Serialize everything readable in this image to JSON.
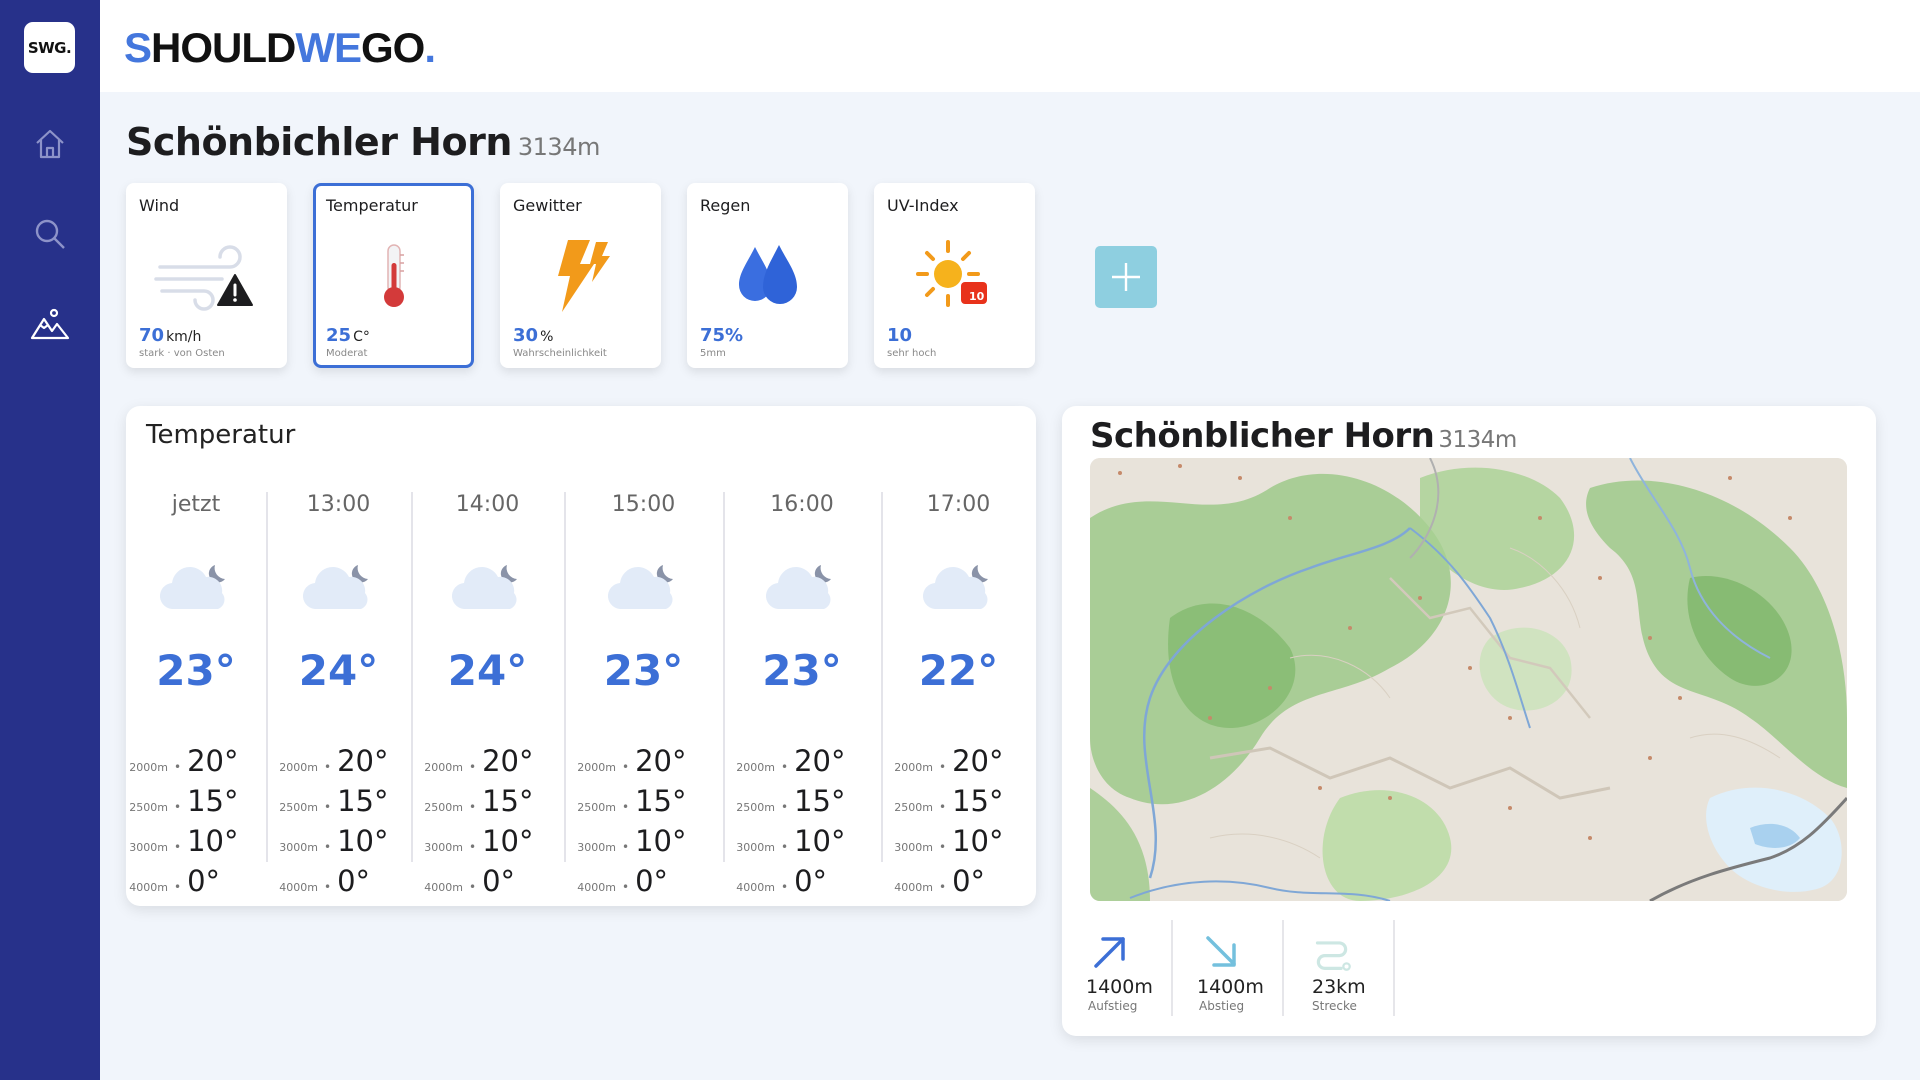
{
  "app": {
    "logo_text": "SWG.",
    "brand_part1": "S",
    "brand_part2": "HOULD",
    "brand_part3": "WE",
    "brand_part4": "GO",
    "brand_part5": ".",
    "accent_color": "#3c6fd6",
    "sidebar_color": "#27318a"
  },
  "sidebar": {
    "items": [
      {
        "name": "home",
        "icon": "home-icon"
      },
      {
        "name": "search",
        "icon": "search-icon"
      },
      {
        "name": "mountains",
        "icon": "mountain-icon"
      }
    ]
  },
  "page": {
    "title": "Schönbichler Horn",
    "altitude": "3134m"
  },
  "metrics": [
    {
      "label": "Wind",
      "value": "70",
      "unit": "km/h",
      "sub": "stark · von Osten",
      "icon": "wind-warning-icon"
    },
    {
      "label": "Temperatur",
      "value": "25",
      "unit": "C°",
      "sub": "Moderat",
      "icon": "thermometer-icon",
      "selected": true
    },
    {
      "label": "Gewitter",
      "value": "30",
      "unit": "%",
      "sub": "Wahrscheinlichkeit",
      "icon": "lightning-icon"
    },
    {
      "label": "Regen",
      "value": "75%",
      "unit": "",
      "sub": "5mm",
      "icon": "raindrops-icon"
    },
    {
      "label": "UV-Index",
      "value": "10",
      "unit": "",
      "sub": "sehr hoch",
      "icon": "sun-uv-icon",
      "badge": "10"
    }
  ],
  "temperature": {
    "title": "Temperatur",
    "hours": [
      {
        "time": "jetzt",
        "temp": "23°",
        "alts": [
          {
            "alt": "2000m",
            "val": "20°"
          },
          {
            "alt": "2500m",
            "val": "15°"
          },
          {
            "alt": "3000m",
            "val": "10°"
          },
          {
            "alt": "4000m",
            "val": "0°"
          }
        ]
      },
      {
        "time": "13:00",
        "temp": "24°",
        "alts": [
          {
            "alt": "2000m",
            "val": "20°"
          },
          {
            "alt": "2500m",
            "val": "15°"
          },
          {
            "alt": "3000m",
            "val": "10°"
          },
          {
            "alt": "4000m",
            "val": "0°"
          }
        ]
      },
      {
        "time": "14:00",
        "temp": "24°",
        "alts": [
          {
            "alt": "2000m",
            "val": "20°"
          },
          {
            "alt": "2500m",
            "val": "15°"
          },
          {
            "alt": "3000m",
            "val": "10°"
          },
          {
            "alt": "4000m",
            "val": "0°"
          }
        ]
      },
      {
        "time": "15:00",
        "temp": "23°",
        "alts": [
          {
            "alt": "2000m",
            "val": "20°"
          },
          {
            "alt": "2500m",
            "val": "15°"
          },
          {
            "alt": "3000m",
            "val": "10°"
          },
          {
            "alt": "4000m",
            "val": "0°"
          }
        ]
      },
      {
        "time": "16:00",
        "temp": "23°",
        "alts": [
          {
            "alt": "2000m",
            "val": "20°"
          },
          {
            "alt": "2500m",
            "val": "15°"
          },
          {
            "alt": "3000m",
            "val": "10°"
          },
          {
            "alt": "4000m",
            "val": "0°"
          }
        ]
      },
      {
        "time": "17:00",
        "temp": "22°",
        "alts": [
          {
            "alt": "2000m",
            "val": "20°"
          },
          {
            "alt": "2500m",
            "val": "15°"
          },
          {
            "alt": "3000m",
            "val": "10°"
          },
          {
            "alt": "4000m",
            "val": "0°"
          }
        ]
      }
    ]
  },
  "route": {
    "title": "Schönblicher Horn",
    "altitude": "3134m",
    "stats": [
      {
        "value": "1400m",
        "label": "Aufstieg",
        "icon": "arrow-up-right-icon"
      },
      {
        "value": "1400m",
        "label": "Abstieg",
        "icon": "arrow-down-right-icon"
      },
      {
        "value": "23km",
        "label": "Strecke",
        "icon": "route-icon"
      }
    ]
  }
}
